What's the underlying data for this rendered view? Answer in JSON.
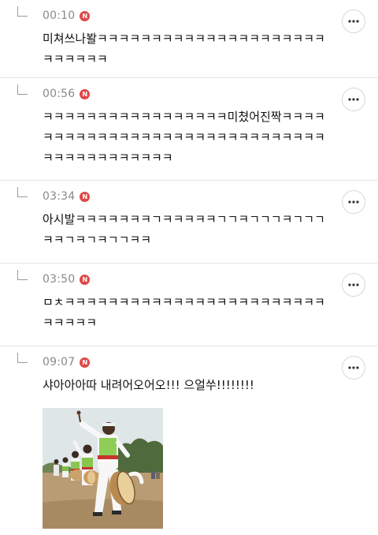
{
  "badge_letter": "N",
  "colors": {
    "badge": "#e04848",
    "timestamp": "#8a8a8a",
    "divider": "#e6e6e6"
  },
  "icons": {
    "reply_indicator": "reply-arrow-icon",
    "more": "more-horizontal-icon"
  },
  "replies": [
    {
      "time": "00:10",
      "text": "미쳐쓰나봘ㅋㅋㅋㅋㅋㅋㅋㅋㅋㅋㅋㅋㅋㅋㅋㅋㅋㅋㅋㅋㅋㅋㅋㅋㅋㅋㅋ"
    },
    {
      "time": "00:56",
      "text": "ㅋㅋㅋㅋㅋㅋㅋㅋㅋㅋㅋㅋㅋㅋㅋㅋㅋ미쳤어진짝ㅋㅋㅋㅋㅋㅋㅋㅋㅋㅋㅋㅋㅋㅋㅋㅋㅋㅋㅋㅋㅋㅋㅋㅋㅋㅋㅋㅋㅋㅋㅋㅋㅋㅋㅋㅋㅋㅋㅋㅋㅋㅋ"
    },
    {
      "time": "03:34",
      "text": "아시발ㅋㅋㅋㅋㅋㅋㅋㄱㅋㅋㅋㅋㅋㄱㄱㅋㄱㄱㄱㅋㄱㄱㄱㅋㅋㄱㅋㄱㅋㄱㄱㅋㅋ"
    },
    {
      "time": "03:50",
      "text": "ㅁㅊㅋㅋㅋㅋㅋㅋㅋㅋㅋㅋㅋㅋㅋㅋㅋㅋㅋㅋㅋㅋㅋㅋㅋㅋㅋㅋㅋㅋㅋ"
    },
    {
      "time": "09:07",
      "text": "샤아아아따 내려어오어오!!! 으얼쑤!!!!!!!!",
      "has_image": true
    }
  ]
}
